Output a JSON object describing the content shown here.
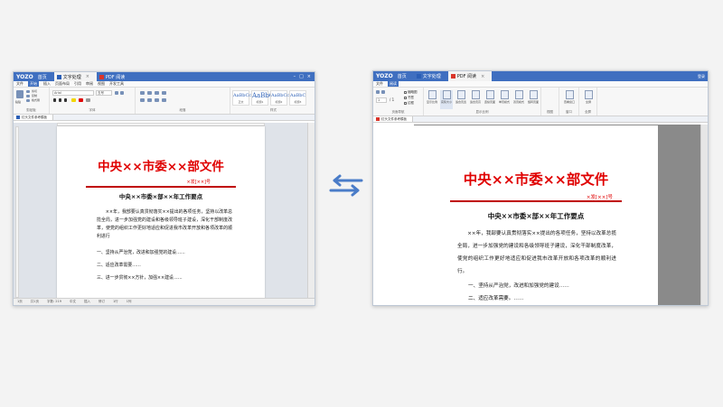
{
  "left_window": {
    "app": "YOZO",
    "home_tab": "首页",
    "doc_tab": "文字处理",
    "pdf_tab": "PDF 阅读",
    "menu": [
      "文件",
      "开始",
      "插入",
      "页面布局",
      "引用",
      "审阅",
      "视图",
      "开发工具"
    ],
    "menu_selected": "开始",
    "font_name": "Arial",
    "font_size": "五号",
    "styles": [
      {
        "sample": "AaBbCcDd",
        "label": "正文"
      },
      {
        "sample": "AaBbC",
        "label": "标题1"
      },
      {
        "sample": "AaBbCcDd",
        "label": "标题2"
      },
      {
        "sample": "AaBbC",
        "label": "标题3"
      }
    ],
    "groups": [
      "剪贴板",
      "字体",
      "段落",
      "样式"
    ],
    "ribbon_small_labels": [
      "剪切",
      "复制",
      "粘贴",
      "格式刷"
    ],
    "document_tab": "红头文件参考模板",
    "statusbar": [
      "1页",
      "共1页",
      "字数: 219",
      "中文",
      "插入",
      "修订",
      "1行",
      "1列"
    ]
  },
  "right_window": {
    "app": "YOZO",
    "home_tab": "首页",
    "doc_tab": "文字处理",
    "pdf_tab": "PDF 阅读",
    "menu": [
      "文件",
      "阅读"
    ],
    "menu_selected": "阅读",
    "checks": [
      "缩略图",
      "书签",
      "边框"
    ],
    "nav_buttons": [
      "显示比例",
      "实际大小",
      "适合页宽",
      "适合页高",
      "连续页面",
      "单页模式",
      "双页模式",
      "旋转页面",
      "查看窗口",
      "全屏"
    ],
    "groups": [
      "页面导航",
      "显示比例",
      "视图",
      "窗口",
      "全屏"
    ],
    "page_input": "1",
    "page_total": "/ 1",
    "account": "登录",
    "document_tab": "红头文件参考模板"
  },
  "document": {
    "title": "中央××市委××部文件",
    "number": "×发[××]号",
    "subtitle": "中央××市委×部××年工作要点",
    "paragraph": "××年，我部要认真贯彻落实××提出的各项任务，坚持以改革总揽全局，进一步加强党的建设和各级领导班子建设，深化干部制度改革，使党的组织工作更好地适应和促进我市改革开放和各项改革的顺利进行",
    "paragraph_pdf": "××年，我部要认真贯彻落实××提出的各项任务，坚持以改革总揽全局，进一步加强党的建设和各级领导班子建设，深化干部制度改革，使党的组织工作更好地适应和促进我市改革开放和各项改革的顺利进行。",
    "items": [
      "一、坚持从严治党，改进和加强党的建设……",
      "二、适应改革需要……",
      "三、进一步贯彻××方针，加强××建设……"
    ],
    "items_pdf": [
      "一、坚持从严治党，改进和加强党的建设……",
      "二、适应改革需要。……"
    ]
  },
  "colors": {
    "title_bar": "#3f6fc0",
    "red_heading": "#e00000",
    "arrow": "#4a7cc8"
  }
}
